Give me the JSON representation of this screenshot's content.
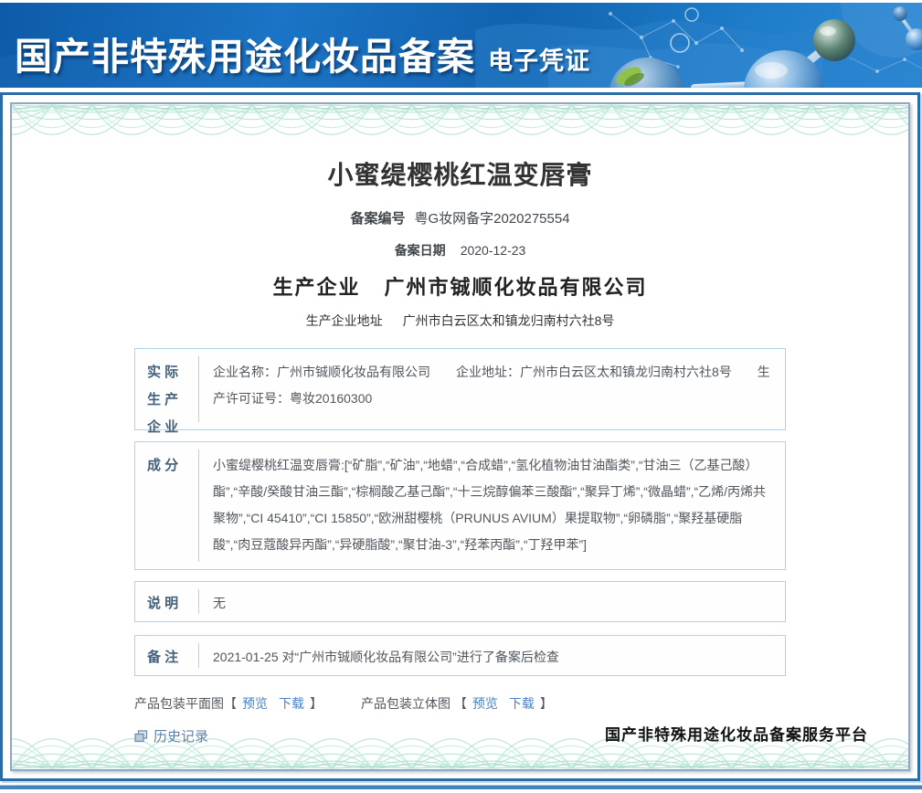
{
  "banner": {
    "title": "国产非特殊用途化妆品备案",
    "subtitle": "电子凭证"
  },
  "certificate": {
    "product_name": "小蜜缇樱桃红温变唇膏",
    "record_no_label": "备案编号",
    "record_no": "粤G妆网备字2020275554",
    "record_date_label": "备案日期",
    "record_date": "2020-12-23",
    "manufacturer_label": "生产企业",
    "manufacturer": "广州市铖顺化妆品有限公司",
    "manufacturer_address_label": "生产企业地址",
    "manufacturer_address": "广州市白云区太和镇龙归南村六社8号",
    "table": {
      "rows": [
        {
          "label": "实 际\n生 产\n企 业",
          "content": "企业名称：广州市铖顺化妆品有限公司　　企业地址：广州市白云区太和镇龙归南村六社8号　　生产许可证号：粤妆20160300"
        },
        {
          "label": "成 分",
          "content": "小蜜缇樱桃红温变唇膏:[“矿脂”,“矿油”,“地蜡”,“合成蜡”,“氢化植物油甘油酯类”,“甘油三（乙基己酸）酯”,“辛酸/癸酸甘油三酯”,“棕榈酸乙基己酯”,“十三烷醇偏苯三酸酯”,“聚异丁烯”,“微晶蜡”,“乙烯/丙烯共聚物”,“CI 45410”,“CI 15850”,“欧洲甜樱桃（PRUNUS AVIUM）果提取物”,“卵磷脂”,“聚羟基硬脂酸”,“肉豆蔻酸异丙酯”,“异硬脂酸”,“聚甘油-3”,“羟苯丙酯”,“丁羟甲苯”]"
        },
        {
          "label": "说 明",
          "content": "无"
        },
        {
          "label": "备 注",
          "content": "2021-01-25 对“广州市铖顺化妆品有限公司”进行了备案后检查"
        }
      ]
    },
    "packaging": {
      "flat_label": "产品包装平面图",
      "stereo_label": "产品包装立体图",
      "bracket_open": "【",
      "bracket_close": "】",
      "preview": "预览",
      "download": "下载"
    },
    "history_label": "历史记录",
    "platform_name": "国产非特殊用途化妆品备案服务平台"
  },
  "colors": {
    "banner_blue": "#1467b3",
    "frame_blue": "#2a6ca8",
    "table_border": "#aed2e8",
    "link_blue": "#4a7fc0",
    "history_link": "#5b80a5",
    "guilloche_green": "#9fdcc8"
  }
}
